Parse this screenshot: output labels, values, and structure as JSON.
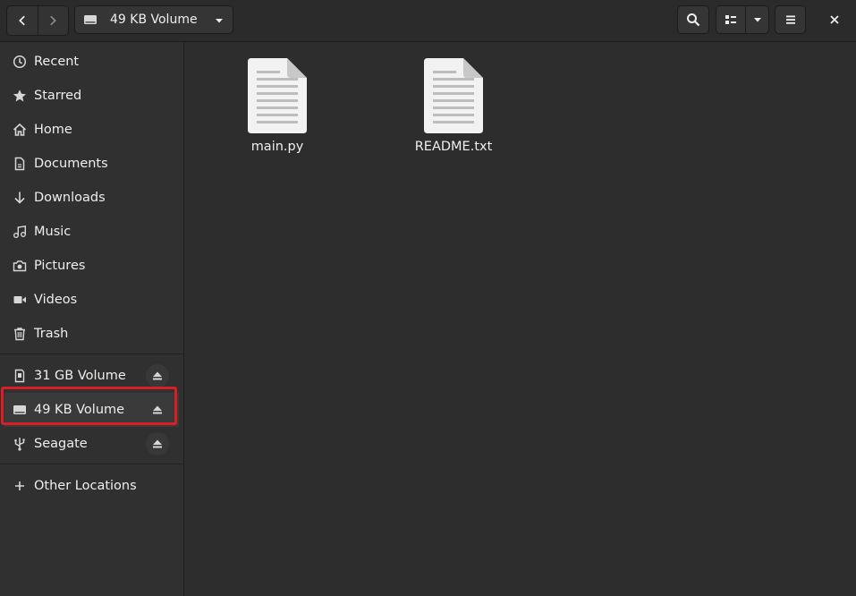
{
  "header": {
    "path_label": "49 KB Volume"
  },
  "sidebar": {
    "places": [
      {
        "label": "Recent",
        "icon": "clock-icon"
      },
      {
        "label": "Starred",
        "icon": "star-icon"
      },
      {
        "label": "Home",
        "icon": "home-icon"
      },
      {
        "label": "Documents",
        "icon": "document-icon"
      },
      {
        "label": "Downloads",
        "icon": "download-icon"
      },
      {
        "label": "Music",
        "icon": "music-icon"
      },
      {
        "label": "Pictures",
        "icon": "camera-icon"
      },
      {
        "label": "Videos",
        "icon": "video-icon"
      },
      {
        "label": "Trash",
        "icon": "trash-icon"
      }
    ],
    "devices": [
      {
        "label": "31 GB Volume",
        "icon": "sdcard-icon"
      },
      {
        "label": "49 KB Volume",
        "icon": "drive-icon",
        "selected": true
      },
      {
        "label": "Seagate",
        "icon": "usb-icon"
      }
    ],
    "other_locations": "Other Locations"
  },
  "files": [
    {
      "name": "main.py",
      "icon": "text-file-icon"
    },
    {
      "name": "README.txt",
      "icon": "text-file-icon"
    }
  ],
  "colors": {
    "highlight": "#d91f26",
    "background": "#2d2d2d",
    "sidebar": "#303030"
  }
}
